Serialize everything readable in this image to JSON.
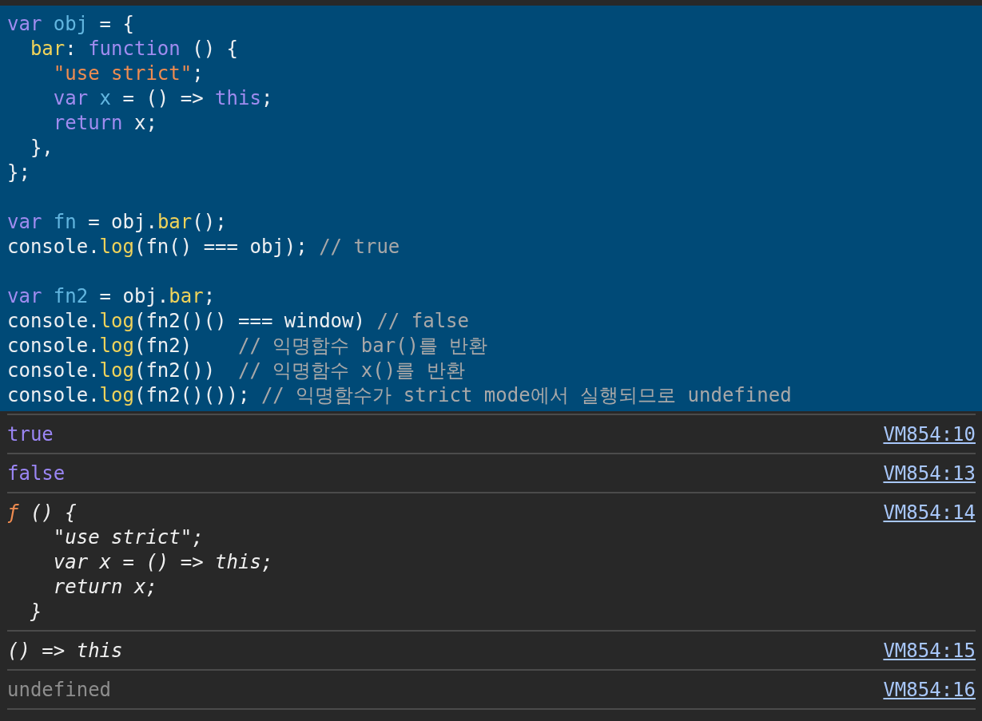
{
  "code_block": {
    "groups": [
      {
        "lines": [
          {
            "tokens": [
              {
                "kind": "keyword",
                "text": "var"
              },
              {
                "kind": "variable",
                "text": " obj"
              },
              {
                "kind": "plain",
                "text": " = {"
              }
            ]
          },
          {
            "tokens": [
              {
                "kind": "property",
                "text": "  bar"
              },
              {
                "kind": "plain",
                "text": ": "
              },
              {
                "kind": "keyword",
                "text": "function"
              },
              {
                "kind": "plain",
                "text": " () {"
              }
            ]
          },
          {
            "tokens": [
              {
                "kind": "string",
                "text": "    \"use strict\""
              },
              {
                "kind": "plain",
                "text": ";"
              }
            ]
          },
          {
            "tokens": [
              {
                "kind": "keyword",
                "text": "    var"
              },
              {
                "kind": "variable",
                "text": " x"
              },
              {
                "kind": "plain",
                "text": " = () => "
              },
              {
                "kind": "keyword",
                "text": "this"
              },
              {
                "kind": "plain",
                "text": ";"
              }
            ]
          },
          {
            "tokens": [
              {
                "kind": "keyword",
                "text": "    return"
              },
              {
                "kind": "plain",
                "text": " x;"
              }
            ]
          },
          {
            "tokens": [
              {
                "kind": "plain",
                "text": "  },"
              }
            ]
          },
          {
            "tokens": [
              {
                "kind": "plain",
                "text": "};"
              }
            ]
          }
        ]
      },
      {
        "lines": [
          {
            "tokens": [
              {
                "kind": "keyword",
                "text": "var"
              },
              {
                "kind": "variable",
                "text": " fn"
              },
              {
                "kind": "plain",
                "text": " = obj."
              },
              {
                "kind": "property",
                "text": "bar"
              },
              {
                "kind": "plain",
                "text": "();"
              }
            ]
          },
          {
            "tokens": [
              {
                "kind": "plain",
                "text": "console."
              },
              {
                "kind": "property",
                "text": "log"
              },
              {
                "kind": "plain",
                "text": "(fn() === obj); "
              },
              {
                "kind": "comment",
                "text": "// true"
              }
            ]
          }
        ]
      },
      {
        "lines": [
          {
            "tokens": [
              {
                "kind": "keyword",
                "text": "var"
              },
              {
                "kind": "variable",
                "text": " fn2"
              },
              {
                "kind": "plain",
                "text": " = obj."
              },
              {
                "kind": "property",
                "text": "bar"
              },
              {
                "kind": "plain",
                "text": ";"
              }
            ]
          },
          {
            "tokens": [
              {
                "kind": "plain",
                "text": "console."
              },
              {
                "kind": "property",
                "text": "log"
              },
              {
                "kind": "plain",
                "text": "(fn2()() === window) "
              },
              {
                "kind": "comment",
                "text": "// false"
              }
            ]
          },
          {
            "tokens": [
              {
                "kind": "plain",
                "text": "console."
              },
              {
                "kind": "property",
                "text": "log"
              },
              {
                "kind": "plain",
                "text": "(fn2)    "
              },
              {
                "kind": "comment",
                "text": "// 익명함수 bar()를 반환"
              }
            ]
          },
          {
            "tokens": [
              {
                "kind": "plain",
                "text": "console."
              },
              {
                "kind": "property",
                "text": "log"
              },
              {
                "kind": "plain",
                "text": "(fn2())  "
              },
              {
                "kind": "comment",
                "text": "// 익명함수 x()를 반환"
              }
            ]
          },
          {
            "tokens": [
              {
                "kind": "plain",
                "text": "console."
              },
              {
                "kind": "property",
                "text": "log"
              },
              {
                "kind": "plain",
                "text": "(fn2()()); "
              },
              {
                "kind": "comment",
                "text": "// 익명함수가 strict mode에서 실행되므로 undefined"
              }
            ]
          }
        ]
      }
    ]
  },
  "console_messages": [
    {
      "kind": "boolean",
      "text": "true",
      "source": "VM854:10"
    },
    {
      "kind": "boolean",
      "text": "false",
      "source": "VM854:13"
    },
    {
      "kind": "function",
      "prefix": "ƒ",
      "text": " () {\n    \"use strict\";\n    var x = () => this;\n    return x;\n  }",
      "source": "VM854:14"
    },
    {
      "kind": "arrow",
      "text": "() => this",
      "source": "VM854:15"
    },
    {
      "kind": "undefined",
      "text": "undefined",
      "source": "VM854:16"
    }
  ]
}
